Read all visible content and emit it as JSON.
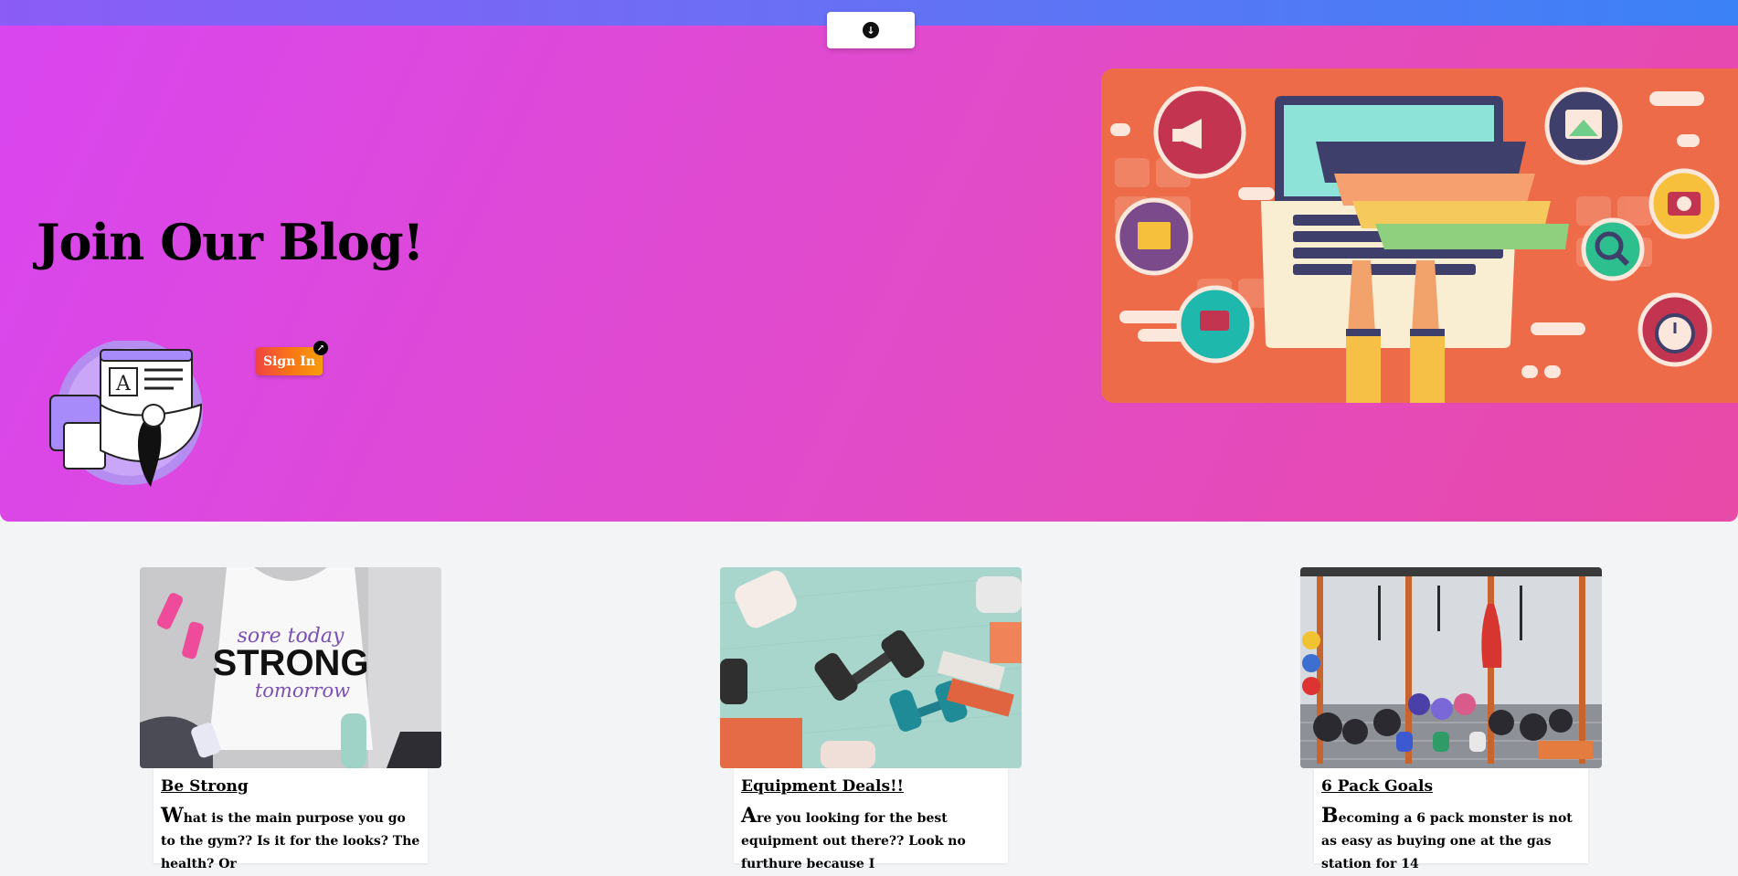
{
  "hero": {
    "title": "Join Our Blog!",
    "signin_label": "Sign In"
  },
  "scroll_icon": "arrow-down-circle-icon",
  "cards": [
    {
      "title": "Be Strong",
      "text_first": "W",
      "text_rest": "hat is the main purpose you go to the gym?? Is it for the looks? The health? Or",
      "shirt_line1": "sore today",
      "shirt_line2": "STRONG",
      "shirt_line3": "tomorrow"
    },
    {
      "title": "Equipment Deals!!",
      "text_first": "A",
      "text_rest": "re you looking for the best equipment out there?? Look no furthure because I"
    },
    {
      "title": "6 Pack Goals",
      "text_first": "B",
      "text_rest": "ecoming a 6 pack monster is not as easy as buying one at the gas station for 14"
    }
  ],
  "colors": {
    "hero_start": "#d946ef",
    "hero_end": "#e84aa8",
    "topbar_start": "#8b5cf6",
    "topbar_end": "#3b82f6",
    "hero_art_bg": "#ee6b4a"
  }
}
